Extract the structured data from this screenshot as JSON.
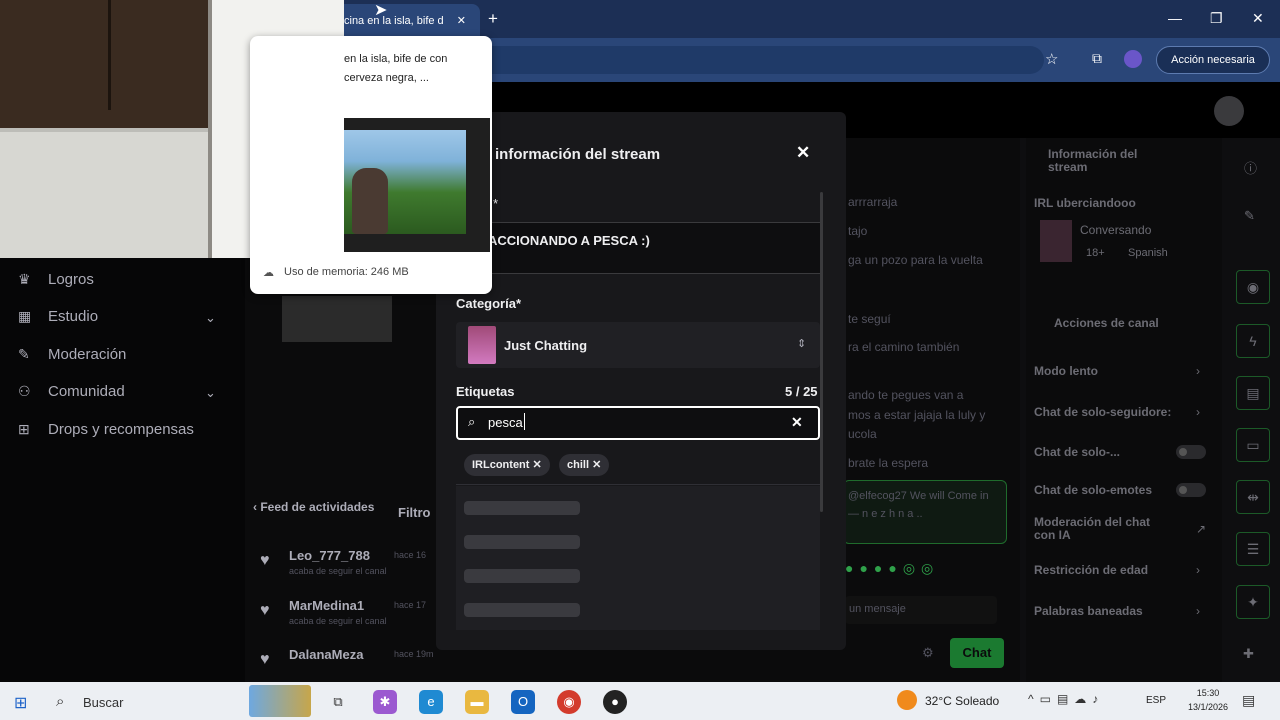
{
  "browser": {
    "tab_title": "cina en la isla, bife d",
    "tab_close": "✕",
    "new_tab": "+",
    "minimize": "—",
    "maximize": "❐",
    "close": "✕",
    "action_button": "Acción necesaria"
  },
  "popup": {
    "text": "en la isla, bife de con cerveza negra, ...",
    "memory": "Uso de memoria: 246 MB"
  },
  "sidebar": {
    "items": [
      {
        "label": "Logros",
        "icon": "trophy-icon"
      },
      {
        "label": "Estudio",
        "icon": "studio-icon"
      },
      {
        "label": "Moderación",
        "icon": "wrench-icon"
      },
      {
        "label": "Comunidad",
        "icon": "community-icon"
      },
      {
        "label": "Drops y recompensas",
        "icon": "gift-icon"
      }
    ]
  },
  "feed": {
    "header": "Feed de actividades",
    "filter": "Filtro",
    "items": [
      {
        "name": "Leo_777_788",
        "time": "hace 16",
        "sub": "acaba de seguir el canal"
      },
      {
        "name": "MarMedina1",
        "time": "hace 17",
        "sub": "acaba de seguir el canal"
      },
      {
        "name": "DalanaMeza",
        "time": "hace 19m",
        "sub": ""
      }
    ]
  },
  "chat": {
    "lines": [
      "arrrarraja",
      "tajo",
      "ga un pozo para la vuelta",
      "te seguí",
      "ra el camino también",
      "ando te pegues van a",
      "mos a estar jajaja la luly y",
      "ucola",
      "brate la espera"
    ],
    "highlight": "@elfecog27 We will Come in — n e z h n a ..",
    "emotes": "●●●●◎◎",
    "input_placeholder": "un mensaje",
    "send": "Chat"
  },
  "right_panel": {
    "info_title": "Información del stream",
    "stream_title": "IRL uberciandooo",
    "category": "Conversando",
    "tag1": "18+",
    "tag2": "Spanish",
    "actions_title": "Acciones de canal",
    "actions": [
      {
        "label": "Modo lento",
        "type": "chevron"
      },
      {
        "label": "Chat de solo-seguidore:",
        "type": "chevron"
      },
      {
        "label": "Chat de solo-...",
        "type": "toggle"
      },
      {
        "label": "Chat de solo-emotes",
        "type": "toggle"
      },
      {
        "label": "Moderación del chat con IA",
        "type": "external"
      },
      {
        "label": "Restricción de edad",
        "type": "chevron"
      },
      {
        "label": "Palabras baneadas",
        "type": "chevron"
      }
    ]
  },
  "modal": {
    "title": "r información del stream",
    "title_label_suffix": "*",
    "stream_title_value": "ACCIONANDO A PESCA :)",
    "category_label": "Categoría*",
    "category_value": "Just Chatting",
    "tags_label": "Etiquetas",
    "tags_count": "5 / 25",
    "tag_input_value": "pesca",
    "tags": [
      "IRLcontent",
      "chill"
    ]
  },
  "taskbar": {
    "search_placeholder": "Buscar",
    "weather": "32°C  Soleado",
    "lang": "ESP",
    "time": "15:30",
    "date": "13/1/2026"
  }
}
